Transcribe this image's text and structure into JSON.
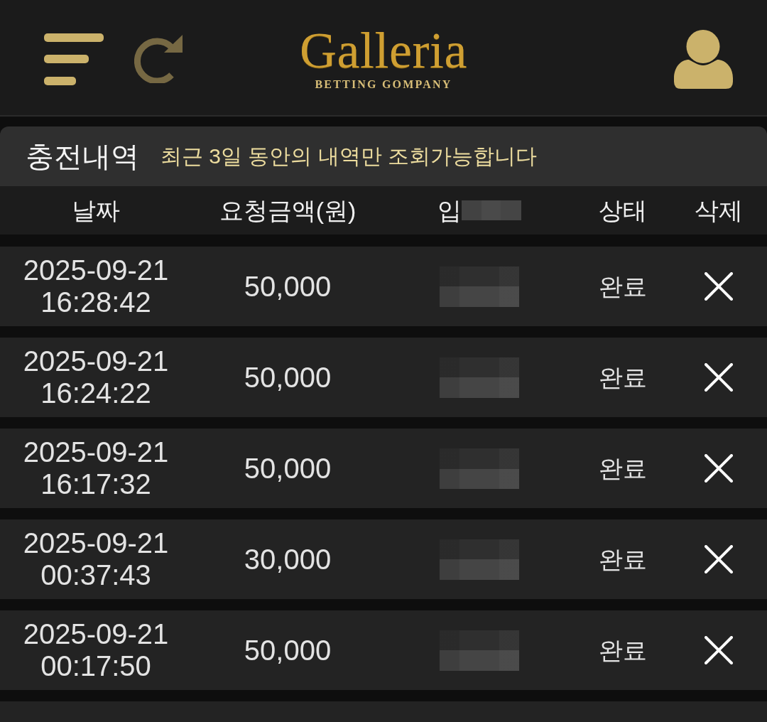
{
  "header": {
    "logo": {
      "name": "Galleria",
      "tagline": "BETTING GOMPANY"
    }
  },
  "panel": {
    "title": "충전내역",
    "notice": "최근 3일 동안의 내역만 조회가능합니다"
  },
  "table": {
    "columns": [
      {
        "label": "날짜",
        "redacted": false
      },
      {
        "label": "요청금액(원)",
        "redacted": false
      },
      {
        "label": "입",
        "redacted": true
      },
      {
        "label": "상태",
        "redacted": false
      },
      {
        "label": "삭제",
        "redacted": false
      }
    ],
    "rows": [
      {
        "date": "2025-09-21",
        "time": "16:28:42",
        "amount": "50,000",
        "column_3_redacted": true,
        "status": "완료"
      },
      {
        "date": "2025-09-21",
        "time": "16:24:22",
        "amount": "50,000",
        "column_3_redacted": true,
        "status": "완료"
      },
      {
        "date": "2025-09-21",
        "time": "16:17:32",
        "amount": "50,000",
        "column_3_redacted": true,
        "status": "완료"
      },
      {
        "date": "2025-09-21",
        "time": "00:37:43",
        "amount": "30,000",
        "column_3_redacted": true,
        "status": "완료"
      },
      {
        "date": "2025-09-21",
        "time": "00:17:50",
        "amount": "50,000",
        "column_3_redacted": true,
        "status": "완료"
      }
    ]
  }
}
